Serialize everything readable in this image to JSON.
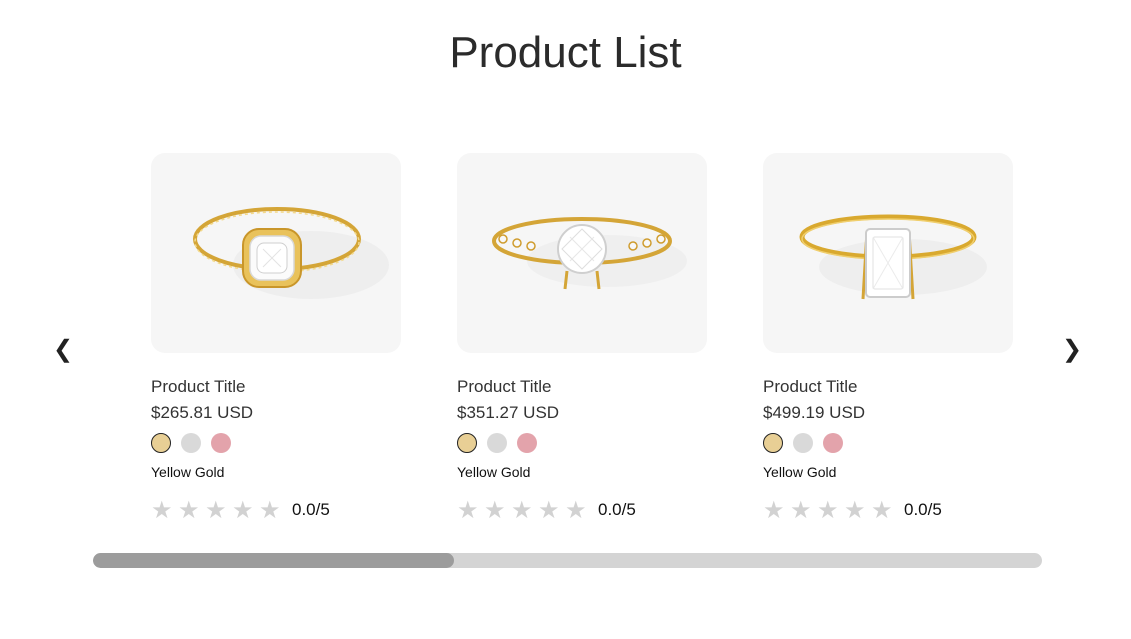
{
  "page": {
    "title": "Product List"
  },
  "nav": {
    "prev": "❮",
    "next": "❯"
  },
  "swatch_colors": {
    "yellow": "#e8cf95",
    "white": "#d9d9d9",
    "rose": "#e3a3ab"
  },
  "products": [
    {
      "title": "Product Title",
      "price": "$265.81 USD",
      "metal": "Yellow Gold",
      "rating": "0.0/5",
      "ring_style": "halo-cushion"
    },
    {
      "title": "Product Title",
      "price": "$351.27 USD",
      "metal": "Yellow Gold",
      "rating": "0.0/5",
      "ring_style": "vintage-round"
    },
    {
      "title": "Product Title",
      "price": "$499.19 USD",
      "metal": "Yellow Gold",
      "rating": "0.0/5",
      "ring_style": "solitaire-emerald"
    }
  ],
  "stars": [
    "★",
    "★",
    "★",
    "★",
    "★"
  ],
  "scroll": {
    "thumb_fraction": 0.38
  }
}
